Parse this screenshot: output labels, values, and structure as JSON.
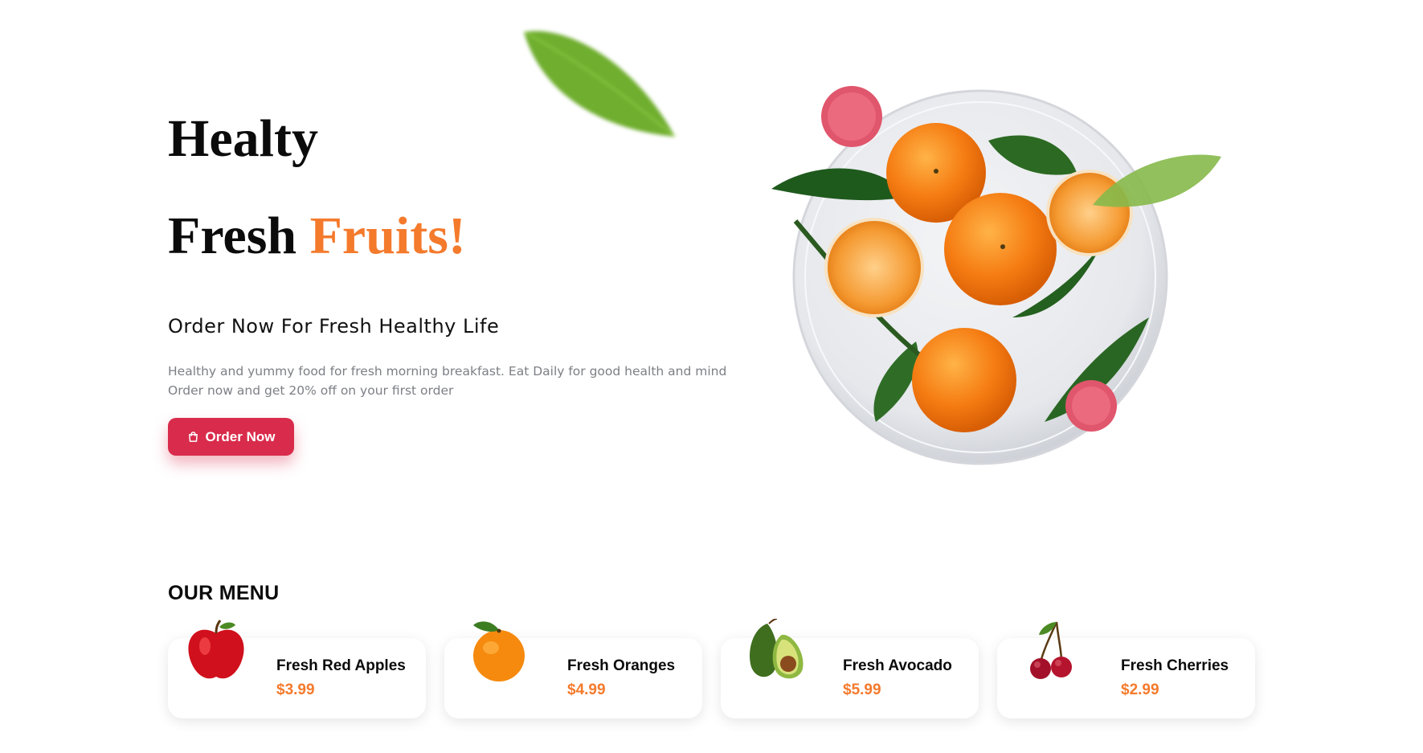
{
  "hero": {
    "title_line1": "Healty",
    "title_line2_plain": "Fresh",
    "title_line2_accent": "Fruits!",
    "subtitle": "Order Now For Fresh Healthy Life",
    "description_line1": "Healthy and yummy food for fresh morning breakfast. Eat Daily for good health and mind",
    "description_line2": "Order now and get 20% off on your first order",
    "order_button_label": "Order Now",
    "order_button_icon": "shopping-bag-icon"
  },
  "menu": {
    "heading": "OUR MENU",
    "items": [
      {
        "name": "Fresh Red Apples",
        "price": "$3.99",
        "icon": "apple-icon"
      },
      {
        "name": "Fresh Oranges",
        "price": "$4.99",
        "icon": "orange-icon"
      },
      {
        "name": "Fresh Avocado",
        "price": "$5.99",
        "icon": "avocado-icon"
      },
      {
        "name": "Fresh Cherries",
        "price": "$2.99",
        "icon": "cherries-icon"
      }
    ]
  },
  "colors": {
    "accent": "#f47a2c",
    "button": "#d92b4b",
    "text_muted": "#7d7f86"
  }
}
